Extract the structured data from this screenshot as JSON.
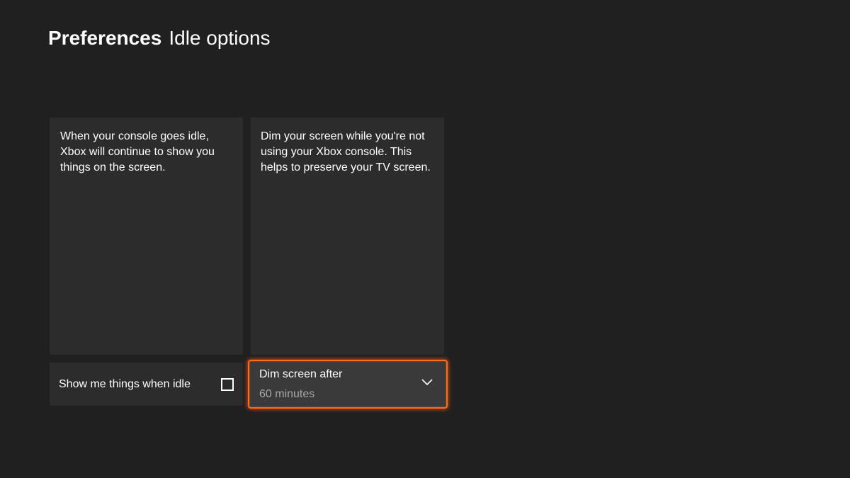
{
  "header": {
    "section": "Preferences",
    "page": "Idle options"
  },
  "cards": {
    "left_description": "When your console goes idle, Xbox will continue to show you things on the screen.",
    "right_description": "Dim your screen while you're not using your Xbox console. This helps to preserve your TV screen."
  },
  "controls": {
    "show_things_label": "Show me things when idle",
    "show_things_checked": false,
    "dim_label": "Dim screen after",
    "dim_value": "60 minutes"
  },
  "icons": {
    "checkbox": "checkbox-icon",
    "chevron": "chevron-down-icon"
  },
  "colors": {
    "background": "#202020",
    "card": "#2c2c2c",
    "focus": "#ff6b1a"
  }
}
